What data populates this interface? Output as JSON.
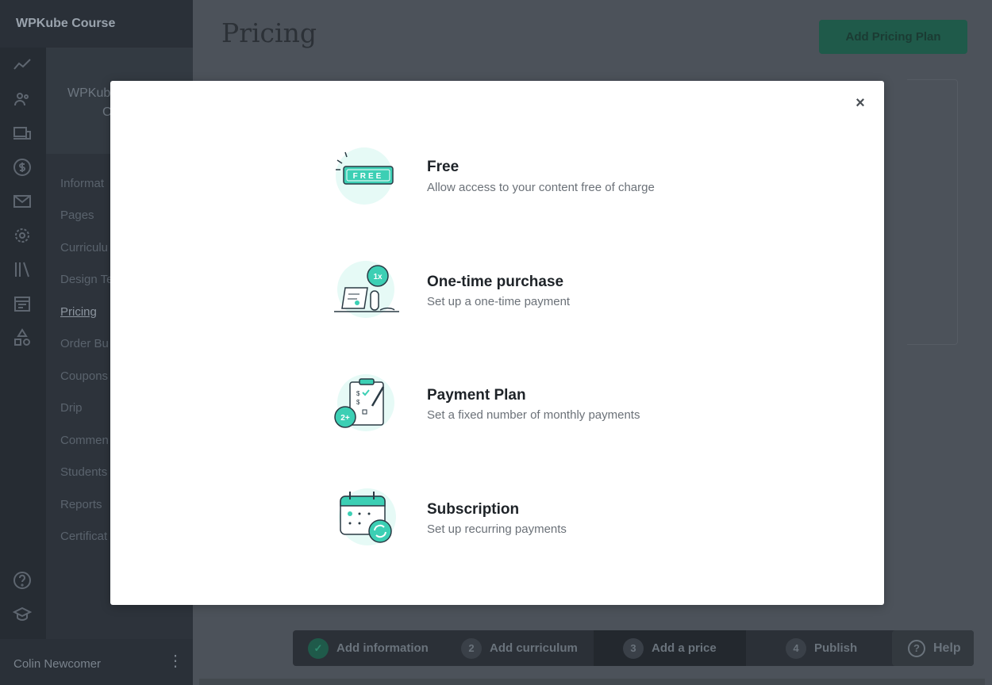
{
  "app": {
    "brand": "WPKube Course"
  },
  "course": {
    "name_line1": "WPKub",
    "name_line2": "C"
  },
  "subnav": {
    "items": [
      {
        "label": "Informat"
      },
      {
        "label": "Pages"
      },
      {
        "label": "Curriculu"
      },
      {
        "label": "Design Te"
      },
      {
        "label": "Pricing"
      },
      {
        "label": "Order Bu"
      },
      {
        "label": "Coupons"
      },
      {
        "label": "Drip"
      },
      {
        "label": "Commen"
      },
      {
        "label": "Students"
      },
      {
        "label": "Reports"
      },
      {
        "label": "Certificat"
      }
    ],
    "active": "Pricing"
  },
  "user": {
    "name": "Colin Newcomer"
  },
  "main": {
    "page_title": "Pricing",
    "add_plan_label": "Add Pricing Plan"
  },
  "steps": [
    {
      "num": "✓",
      "label": "Add information",
      "state": "done"
    },
    {
      "num": "2",
      "label": "Add curriculum",
      "state": "todo"
    },
    {
      "num": "3",
      "label": "Add a price",
      "state": "current"
    },
    {
      "num": "4",
      "label": "Publish",
      "state": "todo"
    }
  ],
  "help": {
    "label": "Help"
  },
  "modal": {
    "close_glyph": "×",
    "options": [
      {
        "title": "Free",
        "desc": "Allow access to your content free of charge",
        "icon": "free-tag-icon"
      },
      {
        "title": "One-time purchase",
        "desc": "Set up a one-time payment",
        "icon": "receipt-1x-icon"
      },
      {
        "title": "Payment Plan",
        "desc": "Set a fixed number of monthly payments",
        "icon": "clipboard-2plus-icon"
      },
      {
        "title": "Subscription",
        "desc": "Set up recurring payments",
        "icon": "calendar-recurring-icon"
      }
    ]
  },
  "colors": {
    "accent": "#3ccfb4",
    "accent_light": "#e6faf6",
    "dark_line": "#2a3a44"
  }
}
